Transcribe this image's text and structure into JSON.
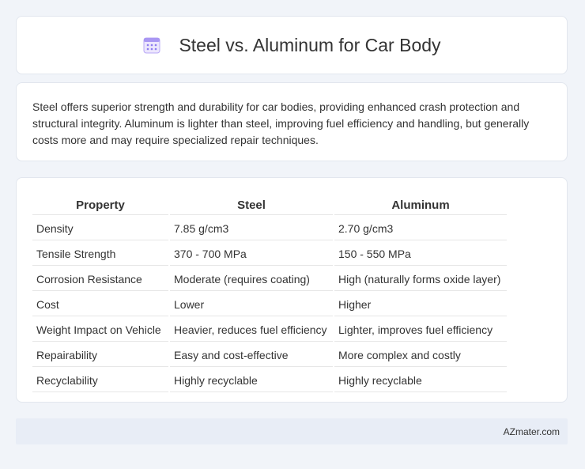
{
  "header": {
    "title": "Steel vs. Aluminum for Car Body",
    "icon": "calendar-icon"
  },
  "summary": {
    "text": "Steel offers superior strength and durability for car bodies, providing enhanced crash protection and structural integrity. Aluminum is lighter than steel, improving fuel efficiency and handling, but generally costs more and may require specialized repair techniques."
  },
  "table": {
    "headers": [
      "Property",
      "Steel",
      "Aluminum"
    ],
    "rows": [
      [
        "Density",
        "7.85 g/cm3",
        "2.70 g/cm3"
      ],
      [
        "Tensile Strength",
        "370 - 700 MPa",
        "150 - 550 MPa"
      ],
      [
        "Corrosion Resistance",
        "Moderate (requires coating)",
        "High (naturally forms oxide layer)"
      ],
      [
        "Cost",
        "Lower",
        "Higher"
      ],
      [
        "Weight Impact on Vehicle",
        "Heavier, reduces fuel efficiency",
        "Lighter, improves fuel efficiency"
      ],
      [
        "Repairability",
        "Easy and cost-effective",
        "More complex and costly"
      ],
      [
        "Recyclability",
        "Highly recyclable",
        "Highly recyclable"
      ]
    ]
  },
  "footer": {
    "text": "AZmater.com"
  },
  "colors": {
    "background": "#f1f4f9",
    "card": "#ffffff",
    "footer": "#e8edf6",
    "icon_accent": "#8e7cf0"
  }
}
